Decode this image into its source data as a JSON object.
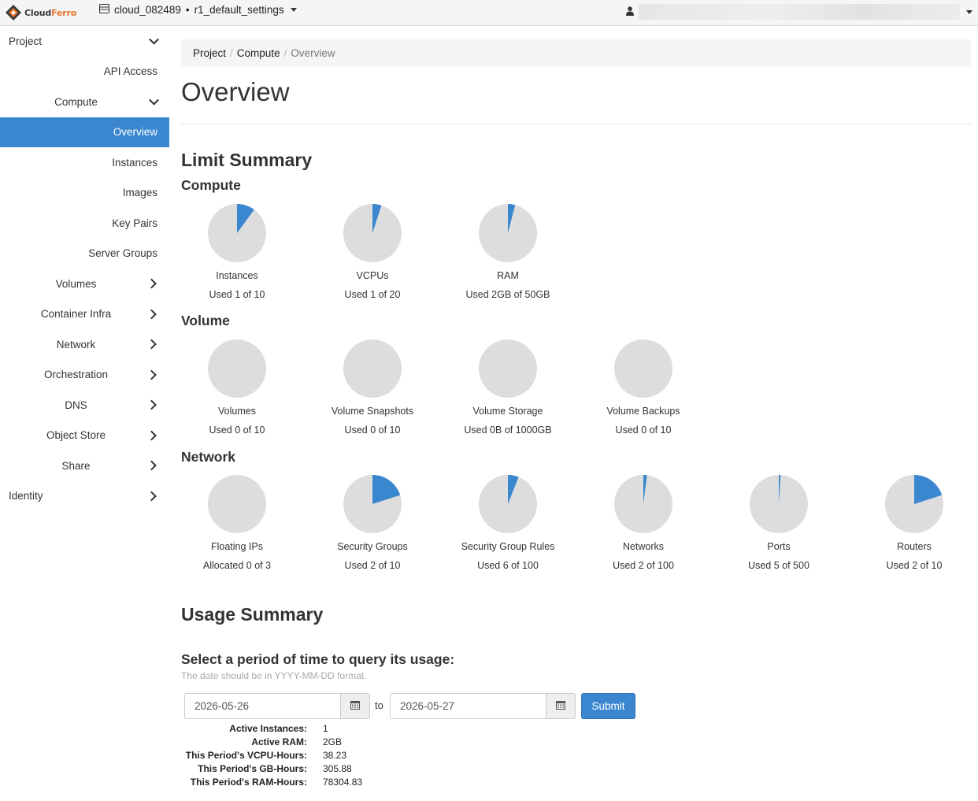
{
  "header": {
    "logo_text_1": "Cloud",
    "logo_text_2": "Ferro",
    "project": "cloud_082489",
    "region": "r1_default_settings",
    "colors": {
      "brand_orange": "#e8742a",
      "brand_dark": "#3a3a3a",
      "accent": "#3a87d0"
    }
  },
  "sidebar": {
    "items": [
      {
        "label": "Project",
        "level": 0,
        "chevron": "down",
        "name": "sidebar-item-project"
      },
      {
        "label": "API Access",
        "level": 2,
        "chevron": "",
        "name": "sidebar-item-api-access"
      },
      {
        "label": "Compute",
        "level": 1,
        "chevron": "down",
        "name": "sidebar-item-compute"
      },
      {
        "label": "Overview",
        "level": 2,
        "chevron": "",
        "active": true,
        "name": "sidebar-item-overview"
      },
      {
        "label": "Instances",
        "level": 2,
        "chevron": "",
        "name": "sidebar-item-instances"
      },
      {
        "label": "Images",
        "level": 2,
        "chevron": "",
        "name": "sidebar-item-images"
      },
      {
        "label": "Key Pairs",
        "level": 2,
        "chevron": "",
        "name": "sidebar-item-key-pairs"
      },
      {
        "label": "Server Groups",
        "level": 2,
        "chevron": "",
        "name": "sidebar-item-server-groups"
      },
      {
        "label": "Volumes",
        "level": 1,
        "chevron": "right",
        "name": "sidebar-item-volumes"
      },
      {
        "label": "Container Infra",
        "level": 1,
        "chevron": "right",
        "name": "sidebar-item-container-infra"
      },
      {
        "label": "Network",
        "level": 1,
        "chevron": "right",
        "name": "sidebar-item-network"
      },
      {
        "label": "Orchestration",
        "level": 1,
        "chevron": "right",
        "name": "sidebar-item-orchestration"
      },
      {
        "label": "DNS",
        "level": 1,
        "chevron": "right",
        "name": "sidebar-item-dns"
      },
      {
        "label": "Object Store",
        "level": 1,
        "chevron": "right",
        "name": "sidebar-item-object-store"
      },
      {
        "label": "Share",
        "level": 1,
        "chevron": "right",
        "name": "sidebar-item-share"
      },
      {
        "label": "Identity",
        "level": 0,
        "chevron": "right",
        "name": "sidebar-item-identity"
      }
    ]
  },
  "breadcrumb": {
    "project": "Project",
    "compute": "Compute",
    "current": "Overview",
    "sep": "/"
  },
  "page_title": "Overview",
  "limit_summary": {
    "title": "Limit Summary",
    "sections": [
      {
        "title": "Compute",
        "pies": [
          {
            "label": "Instances",
            "used_text": "Used 1 of 10",
            "fraction": 0.1
          },
          {
            "label": "VCPUs",
            "used_text": "Used 1 of 20",
            "fraction": 0.05
          },
          {
            "label": "RAM",
            "used_text": "Used 2GB of 50GB",
            "fraction": 0.04
          }
        ]
      },
      {
        "title": "Volume",
        "pies": [
          {
            "label": "Volumes",
            "used_text": "Used 0 of 10",
            "fraction": 0
          },
          {
            "label": "Volume Snapshots",
            "used_text": "Used 0 of 10",
            "fraction": 0
          },
          {
            "label": "Volume Storage",
            "used_text": "Used 0B of 1000GB",
            "fraction": 0
          },
          {
            "label": "Volume Backups",
            "used_text": "Used 0 of 10",
            "fraction": 0
          }
        ]
      },
      {
        "title": "Network",
        "pies": [
          {
            "label": "Floating IPs",
            "used_text": "Allocated 0 of 3",
            "fraction": 0
          },
          {
            "label": "Security Groups",
            "used_text": "Used 2 of 10",
            "fraction": 0.2
          },
          {
            "label": "Security Group Rules",
            "used_text": "Used 6 of 100",
            "fraction": 0.06
          },
          {
            "label": "Networks",
            "used_text": "Used 2 of 100",
            "fraction": 0.02
          },
          {
            "label": "Ports",
            "used_text": "Used 5 of 500",
            "fraction": 0.01
          },
          {
            "label": "Routers",
            "used_text": "Used 2 of 10",
            "fraction": 0.2
          }
        ]
      }
    ],
    "colors": {
      "used": "#3a87d0",
      "free": "#dddddd"
    }
  },
  "usage_summary": {
    "title": "Usage Summary",
    "period_title": "Select a period of time to query its usage:",
    "help_text": "The date should be in YYYY-MM-DD format.",
    "start_date": "2026-05-26",
    "end_date": "2026-05-27",
    "to_label": "to",
    "submit_label": "Submit",
    "stats": [
      {
        "key": "Active Instances:",
        "value": "1"
      },
      {
        "key": "Active RAM:",
        "value": "2GB"
      },
      {
        "key": "This Period's VCPU-Hours:",
        "value": "38.23"
      },
      {
        "key": "This Period's GB-Hours:",
        "value": "305.88"
      },
      {
        "key": "This Period's RAM-Hours:",
        "value": "78304.83"
      }
    ]
  }
}
